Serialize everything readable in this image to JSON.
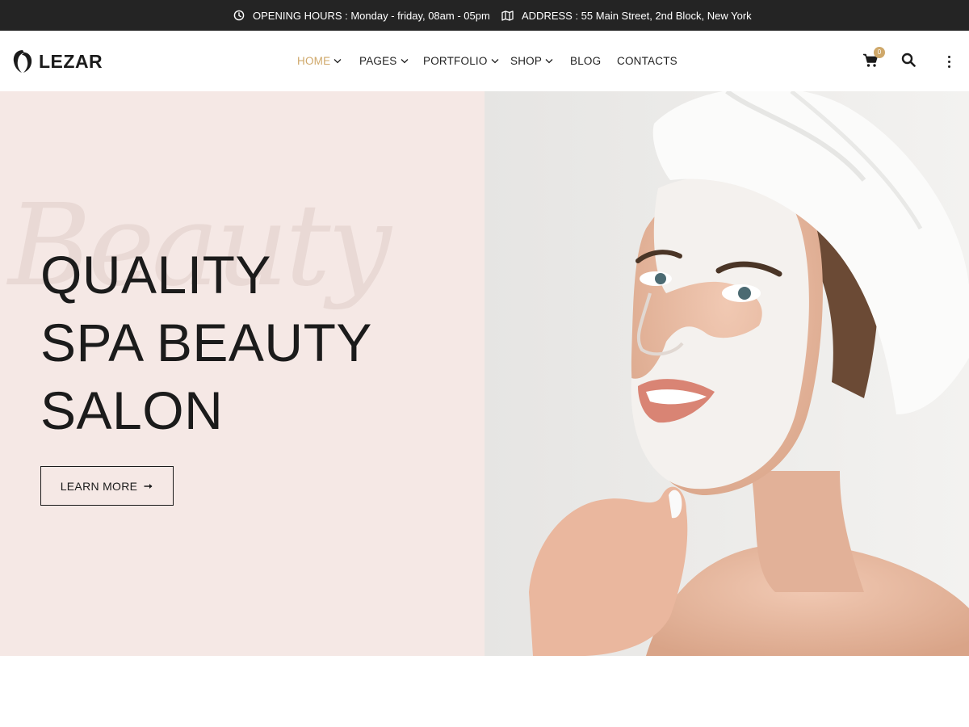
{
  "topbar": {
    "hours": "OPENING HOURS : Monday - friday, 08am - 05pm",
    "address": "ADDRESS : 55 Main Street, 2nd Block, New York"
  },
  "brand": {
    "name": "LEZAR"
  },
  "nav": {
    "items": [
      {
        "label": "HOME",
        "active": true,
        "has_dropdown": true
      },
      {
        "label": "PAGES",
        "has_dropdown": true
      },
      {
        "label": "PORTFOLIO",
        "has_dropdown": true
      },
      {
        "label": "SHOP",
        "has_dropdown": true
      },
      {
        "label": "BLOG",
        "has_dropdown": false
      },
      {
        "label": "CONTACTS",
        "has_dropdown": false
      }
    ]
  },
  "header_actions": {
    "cart_count": "0",
    "icons": [
      "cart-icon",
      "search-icon",
      "more-vertical-icon"
    ]
  },
  "hero": {
    "script_word": "Beauty",
    "title_lines": [
      "QUALITY",
      "SPA BEAUTY",
      "SALON"
    ],
    "button_label": "LEARN MORE",
    "image": "woman-face-mask-photo"
  },
  "colors": {
    "topbar_bg": "#242424",
    "accent": "#cfa86a",
    "hero_bg": "#f5e8e5",
    "text": "#1b1b1b"
  }
}
